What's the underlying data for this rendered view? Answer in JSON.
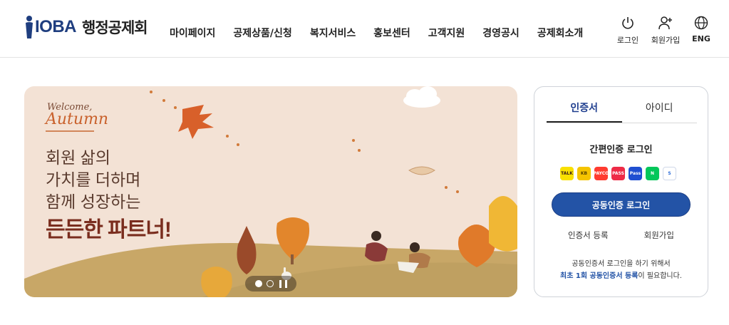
{
  "header": {
    "logo_mark": "IOBA",
    "logo_text": "행정공제회",
    "nav": [
      "마이페이지",
      "공제상품/신청",
      "복지서비스",
      "홍보센터",
      "고객지원",
      "경영공시",
      "공제회소개"
    ],
    "utils": {
      "login": "로그인",
      "signup": "회원가입",
      "lang": "ENG"
    }
  },
  "banner": {
    "welcome": "Welcome,",
    "season": "Autumn",
    "slogan_lines": [
      "회원 삶의",
      "가치를 더하며",
      "함께 성장하는"
    ],
    "slogan_strong": "든든한 파트너!",
    "slides": 2,
    "current_slide": 1
  },
  "login": {
    "tabs": [
      "인증서",
      "아이디"
    ],
    "active_tab": 0,
    "simple_title": "간편인증 로그인",
    "cert_providers": [
      {
        "name": "kakao",
        "label": "TALK",
        "color": "#f9e000",
        "text": "#3a1d1d"
      },
      {
        "name": "kb",
        "label": "KB",
        "color": "#f5c400",
        "text": "#5a4300"
      },
      {
        "name": "payco",
        "label": "PAYCO",
        "color": "#ff3b30",
        "text": "#ffffff"
      },
      {
        "name": "pass",
        "label": "PASS",
        "color": "#ee2b47",
        "text": "#ffffff"
      },
      {
        "name": "samsung-pass",
        "label": "Pass",
        "color": "#1f4fd1",
        "text": "#ffffff"
      },
      {
        "name": "naver",
        "label": "N",
        "color": "#03c75a",
        "text": "#ffffff"
      },
      {
        "name": "shinhan",
        "label": "S",
        "color": "#ffffff",
        "text": "#2a6ad8"
      }
    ],
    "main_button": "공동인증 로그인",
    "link_register": "인증서 등록",
    "link_signup": "회원가입",
    "note_line1": "공동인증서 로그인을 하기 위해서",
    "note_highlight": "최초 1회 공동인증서 등록",
    "note_tail": "이 필요합니다."
  }
}
